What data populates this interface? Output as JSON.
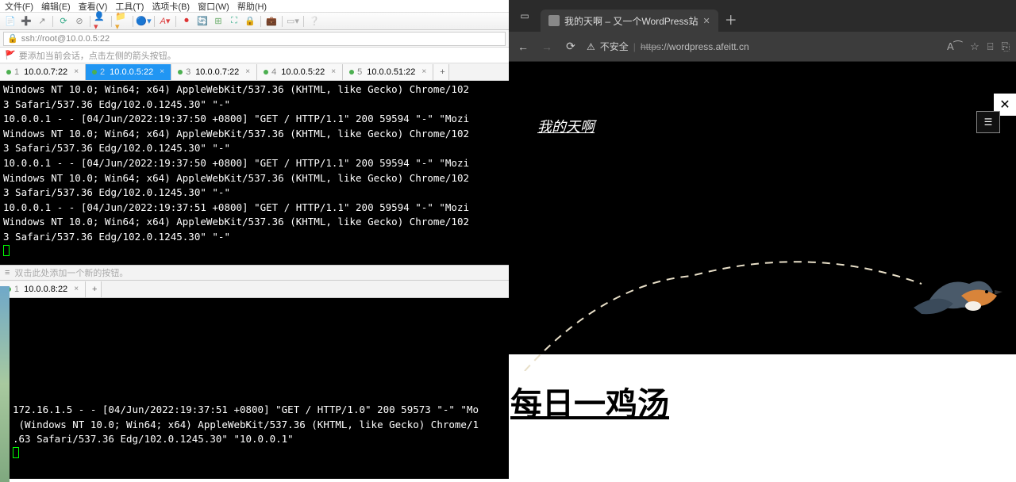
{
  "menu": {
    "file": "文件(F)",
    "edit": "编辑(E)",
    "view": "查看(V)",
    "tools": "工具(T)",
    "tabs": "选项卡(B)",
    "window": "窗口(W)",
    "help": "帮助(H)"
  },
  "address": {
    "url": "ssh://root@10.0.0.5:22"
  },
  "session_hint": "要添加当前会话，点击左侧的箭头按钮。",
  "tabs1": [
    {
      "idx": "1",
      "label": "10.0.0.7:22",
      "active": false
    },
    {
      "idx": "2",
      "label": "10.0.0.5:22",
      "active": true
    },
    {
      "idx": "3",
      "label": "10.0.0.7:22",
      "active": false
    },
    {
      "idx": "4",
      "label": "10.0.0.5:22",
      "active": false
    },
    {
      "idx": "5",
      "label": "10.0.0.51:22",
      "active": false
    }
  ],
  "term1_lines": [
    "Windows NT 10.0; Win64; x64) AppleWebKit/537.36 (KHTML, like Gecko) Chrome/102",
    "3 Safari/537.36 Edg/102.0.1245.30\" \"-\"",
    "10.0.0.1 - - [04/Jun/2022:19:37:50 +0800] \"GET / HTTP/1.1\" 200 59594 \"-\" \"Mozi",
    "Windows NT 10.0; Win64; x64) AppleWebKit/537.36 (KHTML, like Gecko) Chrome/102",
    "3 Safari/537.36 Edg/102.0.1245.30\" \"-\"",
    "10.0.0.1 - - [04/Jun/2022:19:37:50 +0800] \"GET / HTTP/1.1\" 200 59594 \"-\" \"Mozi",
    "Windows NT 10.0; Win64; x64) AppleWebKit/537.36 (KHTML, like Gecko) Chrome/102",
    "3 Safari/537.36 Edg/102.0.1245.30\" \"-\"",
    "10.0.0.1 - - [04/Jun/2022:19:37:51 +0800] \"GET / HTTP/1.1\" 200 59594 \"-\" \"Mozi",
    "Windows NT 10.0; Win64; x64) AppleWebKit/537.36 (KHTML, like Gecko) Chrome/102",
    "3 Safari/537.36 Edg/102.0.1245.30\" \"-\""
  ],
  "btnbar_hint": "双击此处添加一个新的按钮。",
  "tabs2": [
    {
      "idx": "1",
      "label": "10.0.0.8:22",
      "active": false
    }
  ],
  "term2_lines": [
    "",
    "",
    "",
    "",
    "",
    "",
    "",
    "172.16.1.5 - - [04/Jun/2022:19:37:51 +0800] \"GET / HTTP/1.0\" 200 59573 \"-\" \"Mo",
    " (Windows NT 10.0; Win64; x64) AppleWebKit/537.36 (KHTML, like Gecko) Chrome/1",
    ".63 Safari/537.36 Edg/102.0.1245.30\" \"10.0.0.1\""
  ],
  "browser": {
    "tab_title": "我的天啊 – 又一个WordPress站",
    "insecure": "不安全",
    "url_scheme": "https",
    "url_rest": "://wordpress.afeitt.cn",
    "site_title": "我的天啊",
    "page_heading": "每日一鸡汤"
  }
}
